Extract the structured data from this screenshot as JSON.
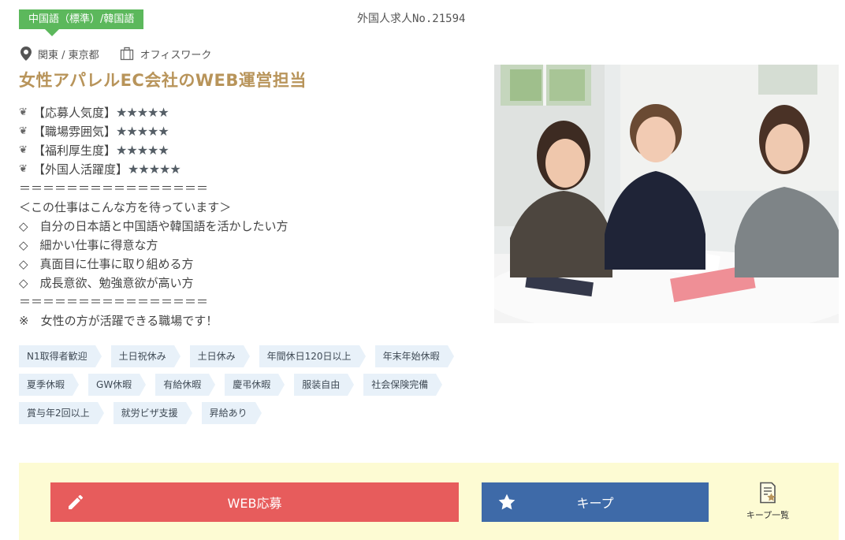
{
  "header": {
    "language_badge": "中国語（標準）/韓国語",
    "job_number": "外国人求人No.21594"
  },
  "meta": {
    "location": "関東 / 東京都",
    "job_type": "オフィスワーク"
  },
  "job": {
    "title": "女性アパレルEC会社のWEB運営担当"
  },
  "ratings": [
    {
      "label": "【応募人気度】",
      "stars": "★★★★★"
    },
    {
      "label": "【職場雰囲気】",
      "stars": "★★★★★"
    },
    {
      "label": "【福利厚生度】",
      "stars": "★★★★★"
    },
    {
      "label": "【外国人活躍度】",
      "stars": "★★★★★"
    }
  ],
  "rating_icon": "❦",
  "description": {
    "divider": "＝＝＝＝＝＝＝＝＝＝＝＝＝＝＝＝",
    "heading": "＜この仕事はこんな方を待っています＞",
    "items": [
      "◇　自分の日本語と中国語や韓国語を活かしたい方",
      "◇　細かい仕事に得意な方",
      "◇　真面目に仕事に取り組める方",
      "◇　成長意欲、勉強意欲が高い方"
    ],
    "note": "※　女性の方が活躍できる職場です！"
  },
  "tags": {
    "row1": [
      "N1取得者歓迎",
      "土日祝休み",
      "土日休み",
      "年間休日120日以上",
      "年末年始休暇"
    ],
    "row2": [
      "夏季休暇",
      "GW休暇",
      "有給休暇",
      "慶弔休暇",
      "服装自由",
      "社会保険完備"
    ],
    "row3": [
      "賞与年2回以上",
      "就労ビザ支援",
      "昇給あり"
    ]
  },
  "actions": {
    "apply_label": "WEB応募",
    "keep_label": "キープ",
    "keep_list_label": "キープ一覧"
  },
  "colors": {
    "badge": "#5cb85c",
    "title": "#b8945a",
    "apply": "#e75c5c",
    "keep": "#3e6aa8",
    "action_bar": "#fdfbd3",
    "tag_bg": "#e8f1f9"
  },
  "icons": {
    "location": "map-pin-icon",
    "job_type": "briefcase-icon",
    "apply": "pencil-icon",
    "keep": "star-icon",
    "keep_list": "document-star-icon"
  }
}
